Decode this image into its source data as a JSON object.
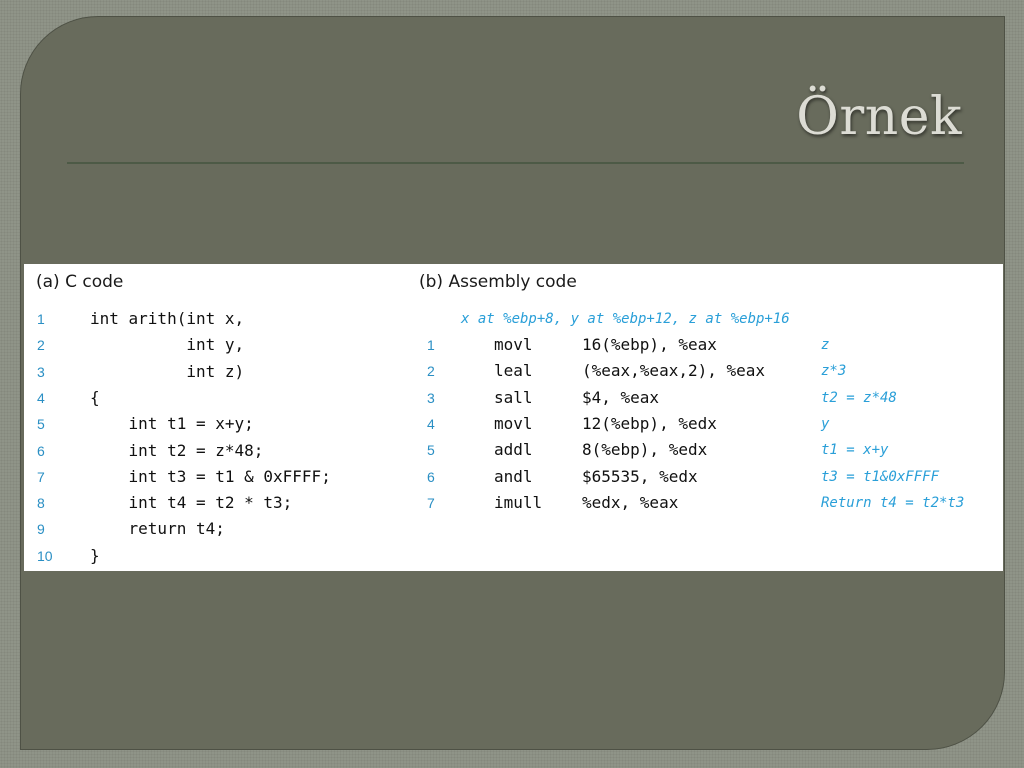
{
  "slide": {
    "title": "Örnek"
  },
  "c_code": {
    "heading": "(a) C code",
    "lines": [
      {
        "n": "1",
        "text": "int arith(int x,"
      },
      {
        "n": "2",
        "text": "          int y,"
      },
      {
        "n": "3",
        "text": "          int z)"
      },
      {
        "n": "4",
        "text": "{"
      },
      {
        "n": "5",
        "text": "    int t1 = x+y;"
      },
      {
        "n": "6",
        "text": "    int t2 = z*48;"
      },
      {
        "n": "7",
        "text": "    int t3 = t1 & 0xFFFF;"
      },
      {
        "n": "8",
        "text": "    int t4 = t2 * t3;"
      },
      {
        "n": "9",
        "text": "    return t4;"
      },
      {
        "n": "10",
        "text": "}"
      }
    ]
  },
  "asm_code": {
    "heading": "(b) Assembly code",
    "header_comment": "x at %ebp+8, y at %ebp+12, z at %ebp+16",
    "lines": [
      {
        "n": "1",
        "op": "movl",
        "args": "16(%ebp), %eax",
        "comment": "z"
      },
      {
        "n": "2",
        "op": "leal",
        "args": "(%eax,%eax,2), %eax",
        "comment": "z*3"
      },
      {
        "n": "3",
        "op": "sall",
        "args": "$4, %eax",
        "comment": "t2 = z*48"
      },
      {
        "n": "4",
        "op": "movl",
        "args": "12(%ebp), %edx",
        "comment": "y"
      },
      {
        "n": "5",
        "op": "addl",
        "args": "8(%ebp), %edx",
        "comment": "t1 = x+y"
      },
      {
        "n": "6",
        "op": "andl",
        "args": "$65535, %edx",
        "comment": "t3 = t1&0xFFFF"
      },
      {
        "n": "7",
        "op": "imull",
        "args": "%edx, %eax",
        "comment": "Return t4 = t2*t3"
      }
    ]
  }
}
